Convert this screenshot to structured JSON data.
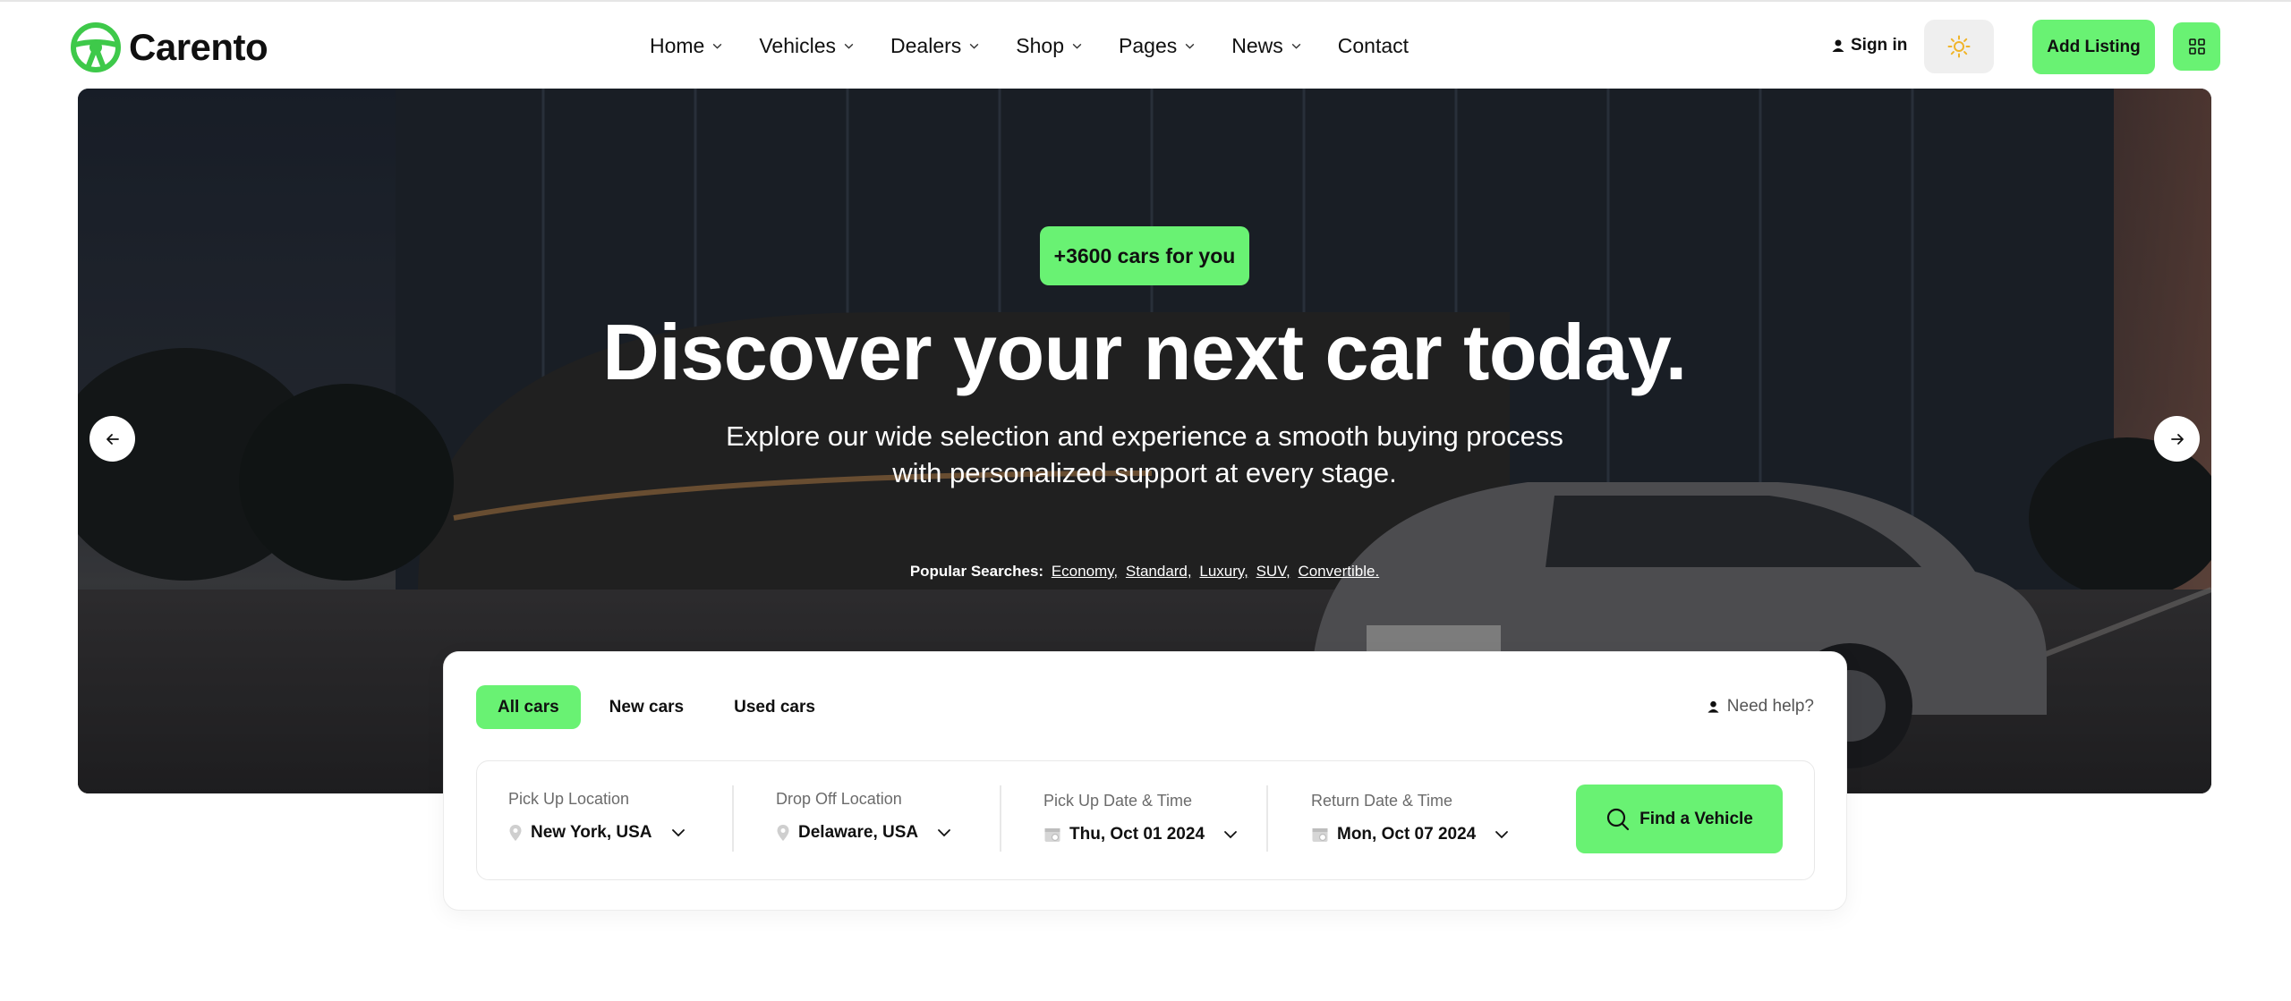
{
  "brand": {
    "name": "Carento"
  },
  "nav": [
    {
      "label": "Home",
      "has_dropdown": true
    },
    {
      "label": "Vehicles",
      "has_dropdown": true
    },
    {
      "label": "Dealers",
      "has_dropdown": true
    },
    {
      "label": "Shop",
      "has_dropdown": true
    },
    {
      "label": "Pages",
      "has_dropdown": true
    },
    {
      "label": "News",
      "has_dropdown": true
    },
    {
      "label": "Contact",
      "has_dropdown": false
    }
  ],
  "header_actions": {
    "signin_label": "Sign in",
    "add_listing_label": "Add Listing",
    "theme_icon": "sun-icon",
    "grid_icon": "grid-icon"
  },
  "hero": {
    "badge": "+3600 cars for you",
    "title": "Discover your next car today.",
    "subtitle_line1": "Explore our wide selection and experience a smooth buying process",
    "subtitle_line2": "with personalized support at every stage.",
    "popular_label": "Popular Searches:",
    "popular_links": [
      "Economy,",
      "Standard,",
      "Luxury,",
      "SUV,",
      "Convertible."
    ]
  },
  "search": {
    "tabs": [
      {
        "label": "All cars",
        "active": true
      },
      {
        "label": "New cars",
        "active": false
      },
      {
        "label": "Used cars",
        "active": false
      }
    ],
    "help_label": "Need help?",
    "fields": {
      "pickup_location": {
        "label": "Pick Up Location",
        "value": "New York, USA"
      },
      "dropoff_location": {
        "label": "Drop Off Location",
        "value": "Delaware, USA"
      },
      "pickup_datetime": {
        "label": "Pick Up Date & Time",
        "value": "Thu, Oct 01 2024"
      },
      "return_datetime": {
        "label": "Return Date & Time",
        "value": "Mon, Oct 07 2024"
      }
    },
    "submit_label": "Find a Vehicle"
  },
  "colors": {
    "accent": "#69f273",
    "text": "#101010",
    "muted": "#6b6b6b"
  }
}
